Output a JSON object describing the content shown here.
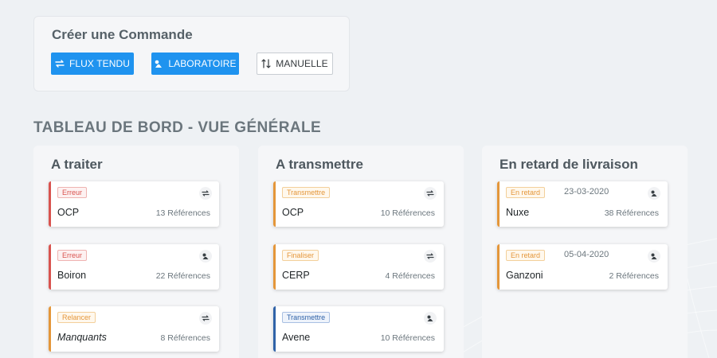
{
  "create": {
    "title": "Créer une Commande",
    "buttons": [
      {
        "label": "FLUX TENDU",
        "icon": "swap-icon"
      },
      {
        "label": "LABORATOIRE",
        "icon": "flask-icon"
      },
      {
        "label": "MANUELLE",
        "icon": "sort-icon"
      }
    ]
  },
  "dashboard": {
    "title": "TABLEAU DE BORD - VUE GÉNÉRALE",
    "columns": [
      {
        "title": "A traiter",
        "cards": [
          {
            "badge": "Erreur",
            "name": "OCP",
            "refs": "13 Références",
            "icon": "swap-icon"
          },
          {
            "badge": "Erreur",
            "name": "Boiron",
            "refs": "22 Références",
            "icon": "flask-icon"
          },
          {
            "badge": "Relancer",
            "name": "Manquants",
            "refs": "8 Références",
            "icon": "swap-icon"
          }
        ]
      },
      {
        "title": "A transmettre",
        "cards": [
          {
            "badge": "Transmettre",
            "name": "OCP",
            "refs": "10 Références",
            "icon": "swap-icon"
          },
          {
            "badge": "Finaliser",
            "name": "CERP",
            "refs": "4 Références",
            "icon": "swap-icon"
          },
          {
            "badge": "Transmettre",
            "name": "Avene",
            "refs": "10 Références",
            "icon": "flask-icon"
          }
        ]
      },
      {
        "title": "En retard de livraison",
        "cards": [
          {
            "badge": "En retard",
            "date": "23-03-2020",
            "name": "Nuxe",
            "refs": "38 Références",
            "icon": "flask-icon"
          },
          {
            "badge": "En retard",
            "date": "05-04-2020",
            "name": "Ganzoni",
            "refs": "2 Références",
            "icon": "flask-icon"
          }
        ]
      }
    ]
  },
  "colors": {
    "primary": "#1f93ef",
    "error": "#d9534f",
    "warning": "#e4963a",
    "info": "#2f62a8"
  }
}
